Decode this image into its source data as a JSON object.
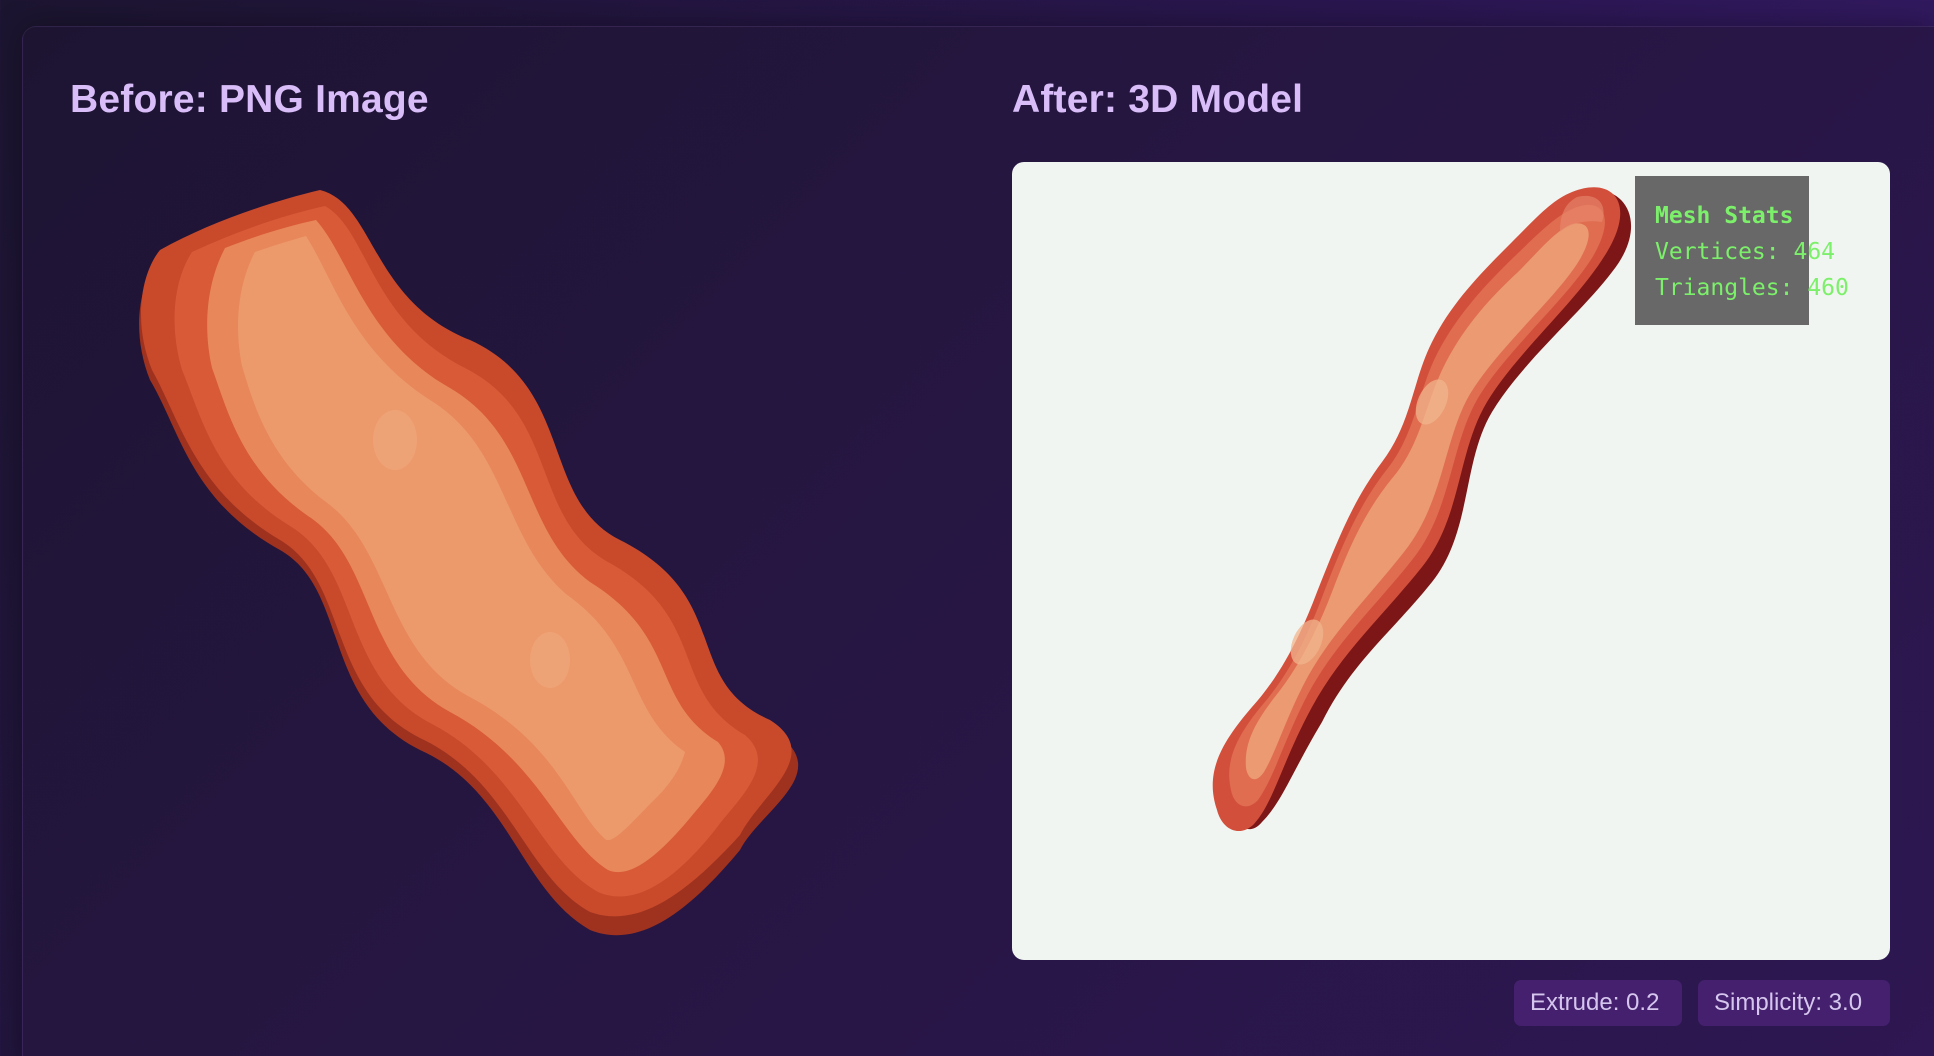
{
  "before": {
    "heading": "Before: PNG Image",
    "image_icon": "bacon-strip-image"
  },
  "after": {
    "heading": "After: 3D Model",
    "model_icon": "bacon-3d-model",
    "viewer_background": "#f1f5f1"
  },
  "mesh_stats": {
    "title": "Mesh Stats",
    "vertices": "Vertices: 464",
    "triangles": "Triangles: 460"
  },
  "settings": {
    "extrude": "Extrude: 0.2",
    "simplicity": "Simplicity: 3.0"
  },
  "colors": {
    "heading": "#d8bdf8",
    "stats_text": "#7cf06a",
    "chip_bg": "#44206e",
    "bacon_outer": "#c9492b",
    "bacon_light": "#e8875a"
  }
}
